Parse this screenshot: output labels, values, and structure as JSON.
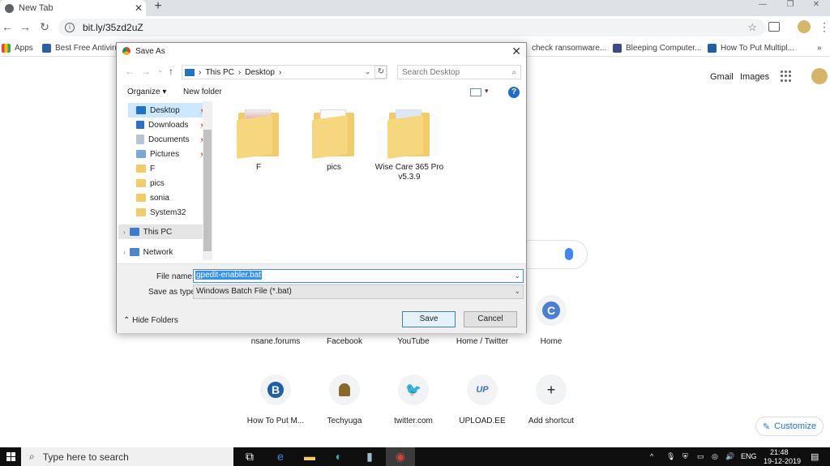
{
  "browser": {
    "tab_title": "New Tab",
    "new_tab": "+",
    "url": "bit.ly/35zd2uZ",
    "bookmarks": [
      "Apps",
      "Best Free Antivirus",
      "check ransomware...",
      "Bleeping Computer...",
      "How To Put Multipl..."
    ],
    "bookmarks_more": "»"
  },
  "page": {
    "gmail": "Gmail",
    "images": "Images",
    "shortcuts_row1": [
      {
        "label": "nsane.forums",
        "glyph": ""
      },
      {
        "label": "Facebook",
        "glyph": ""
      },
      {
        "label": "YouTube",
        "glyph": ""
      },
      {
        "label": "Home / Twitter",
        "glyph": ""
      },
      {
        "label": "Home",
        "glyph": "C"
      }
    ],
    "shortcuts_row2": [
      {
        "label": "How To Put M...",
        "glyph": "B"
      },
      {
        "label": "Techyuga",
        "glyph": ""
      },
      {
        "label": "twitter.com",
        "glyph": ""
      },
      {
        "label": "UPLOAD.EE",
        "glyph": "UP"
      },
      {
        "label": "Add shortcut",
        "glyph": "+"
      }
    ],
    "customize": "Customize"
  },
  "dialog": {
    "title": "Save As",
    "breadcrumb": [
      "This PC",
      "Desktop"
    ],
    "search_placeholder": "Search Desktop",
    "organize": "Organize ▾",
    "new_folder": "New folder",
    "nav_items": [
      {
        "label": "Desktop",
        "color": "#1e73c8",
        "pinned": true
      },
      {
        "label": "Downloads",
        "color": "#2b6fc7",
        "pinned": true
      },
      {
        "label": "Documents",
        "color": "#b8c4d4",
        "pinned": true
      },
      {
        "label": "Pictures",
        "color": "#7aa7d8",
        "pinned": true
      },
      {
        "label": "F",
        "color": "#f3cc6a",
        "pinned": false
      },
      {
        "label": "pics",
        "color": "#f3cc6a",
        "pinned": false
      },
      {
        "label": "sonia",
        "color": "#f3cc6a",
        "pinned": false
      },
      {
        "label": "System32",
        "color": "#f3cc6a",
        "pinned": false
      }
    ],
    "this_pc": "This PC",
    "network": "Network",
    "files": [
      "F",
      "pics",
      "Wise Care 365 Pro v5.3.9"
    ],
    "file_name_label": "File name:",
    "file_name": "gpedit-enabler.bat",
    "save_type_label": "Save as type:",
    "save_type": "Windows Batch File (*.bat)",
    "hide_folders": "Hide Folders",
    "save": "Save",
    "cancel": "Cancel"
  },
  "taskbar": {
    "search": "Type here to search",
    "lang": "ENG",
    "time": "21:48",
    "date": "19-12-2019"
  }
}
